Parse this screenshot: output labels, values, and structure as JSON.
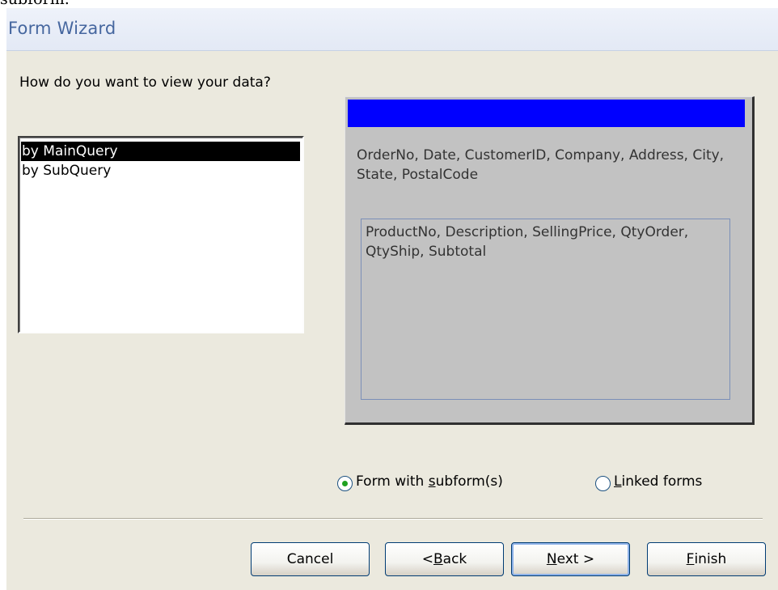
{
  "window": {
    "title": "Form Wizard",
    "cropped_heading": "subform."
  },
  "prompt": "How do you want to view your data?",
  "view_options": [
    {
      "label": "by MainQuery",
      "selected": true
    },
    {
      "label": "by SubQuery",
      "selected": false
    }
  ],
  "preview": {
    "main_fields": "OrderNo, Date, CustomerID, Company, Address, City, State, PostalCode",
    "sub_fields": "ProductNo, Description, SellingPrice, QtyOrder, QtyShip, Subtotal",
    "bar_color": "#0000ff"
  },
  "layout_options": {
    "form_with_subforms": {
      "prefix": "Form with ",
      "accel": "s",
      "suffix": "ubform(s)",
      "checked": true
    },
    "linked_forms": {
      "prefix": "",
      "accel": "L",
      "suffix": "inked forms",
      "checked": false
    }
  },
  "buttons": {
    "cancel": {
      "label": "Cancel"
    },
    "back": {
      "prefix": "< ",
      "accel": "B",
      "suffix": "ack"
    },
    "next": {
      "prefix": "",
      "accel": "N",
      "suffix": "ext >"
    },
    "finish": {
      "prefix": "",
      "accel": "F",
      "suffix": "inish"
    }
  },
  "colors": {
    "title_text": "#46679f",
    "dialog_bg": "#ebe9de",
    "selection_bg": "#000000",
    "radio_dot": "#21a121"
  }
}
